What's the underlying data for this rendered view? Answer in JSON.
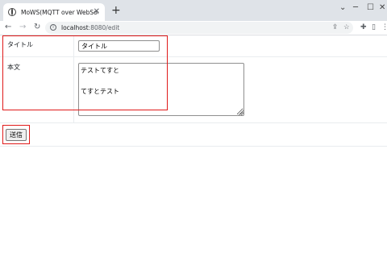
{
  "browser": {
    "tab_title": "MoWS(MQTT over WebSocket)",
    "tab_close": "✕",
    "new_tab": "+",
    "window_controls": {
      "minimize": "─",
      "maximize": "☐",
      "close": "✕",
      "dropdown": "⌄"
    },
    "nav": {
      "back": "←",
      "forward": "→",
      "reload": "↻"
    },
    "url_host": "localhost",
    "url_path": ":8080/edit",
    "icons": [
      "share-icon",
      "bookmark-star-icon",
      "extensions-icon",
      "sidepanel-icon",
      "menu-icon"
    ]
  },
  "form": {
    "title_label": "タイトル",
    "title_value": "タイトル",
    "body_label": "本文",
    "body_value": "テストてすと\n\nてすとテスト",
    "submit_label": "送信"
  },
  "colors": {
    "highlight": "#e01a1a",
    "tabbar": "#dfe3e8",
    "omnibox": "#f1f3f4"
  }
}
